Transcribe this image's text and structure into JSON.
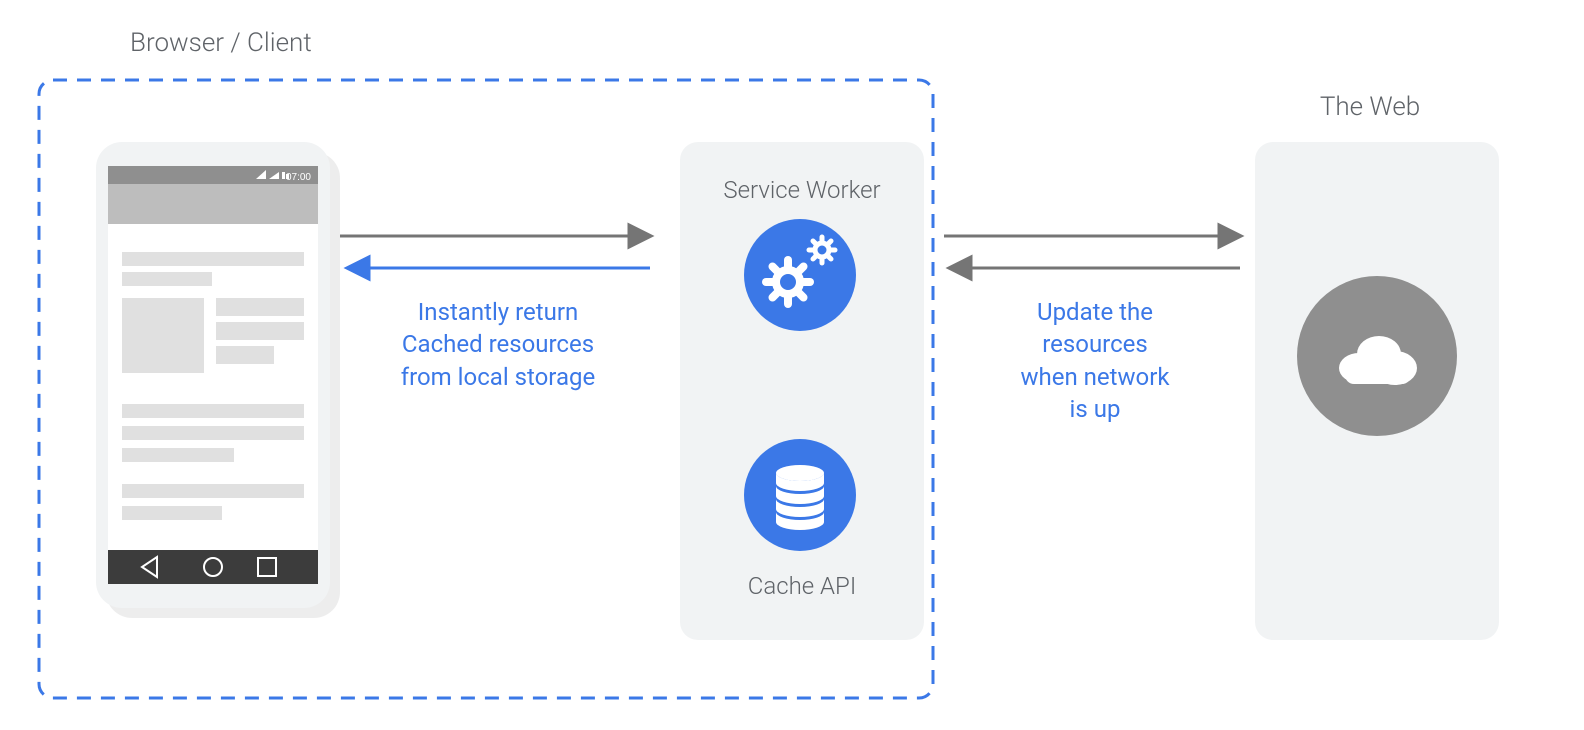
{
  "diagram": {
    "browser_client_title": "Browser / Client",
    "the_web_title": "The Web",
    "service_worker_label": "Service Worker",
    "cache_api_label": "Cache API",
    "instant_return_text": "Instantly return\nCached resources\nfrom local storage",
    "update_resources_text": "Update the\nresources\nwhen network\nis up",
    "phone_status_time": "07:00",
    "colors": {
      "blue": "#3b78e7",
      "gray": "#757575",
      "light_gray": "#E0E0E0",
      "panel_gray": "#f1f3f4",
      "dark_panel": "#8f8f8f",
      "nav_bar": "#3c3c3c"
    }
  }
}
